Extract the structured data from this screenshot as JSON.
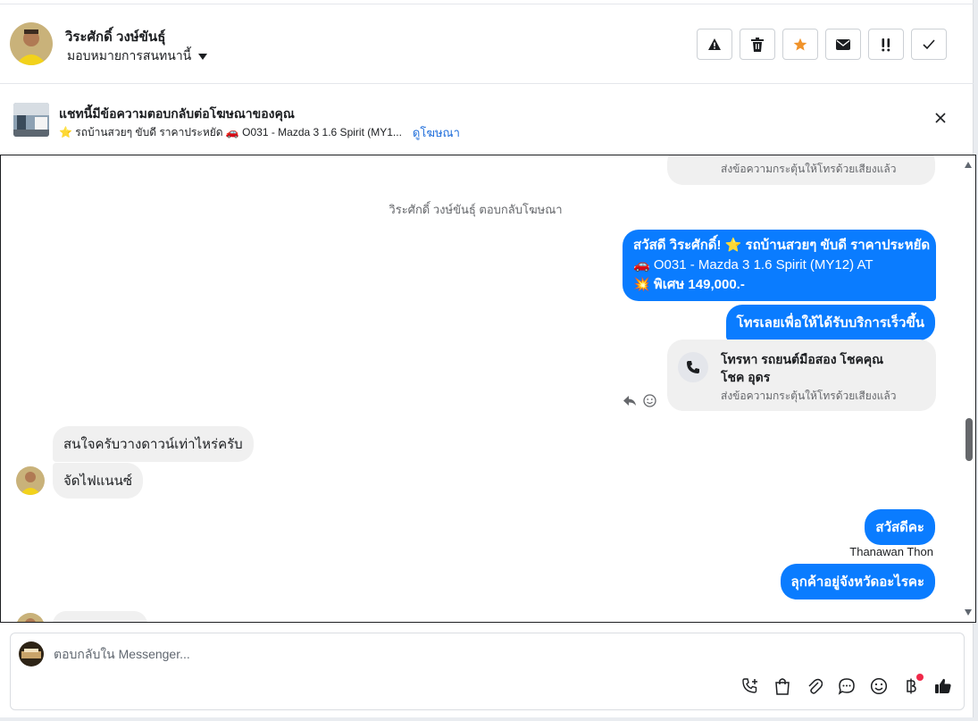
{
  "header": {
    "contact_name": "วิระศักดิ์ วงษ์ขันธุ์",
    "assign_label": "มอบหมายการสนทนานี้",
    "actions": [
      {
        "name": "report-spam-button",
        "icon": "warning-icon"
      },
      {
        "name": "delete-button",
        "icon": "trash-icon"
      },
      {
        "name": "star-button",
        "icon": "star-icon"
      },
      {
        "name": "mark-unread-button",
        "icon": "envelope-icon"
      },
      {
        "name": "follow-up-button",
        "icon": "exclamation-icon"
      },
      {
        "name": "mark-done-button",
        "icon": "check-icon"
      }
    ]
  },
  "ad_banner": {
    "title": "แชทนี้มีข้อความตอบกลับต่อโฆษณาของคุณ",
    "subtitle": "⭐ รถบ้านสวยๆ ขับดี ราคาประหยัด 🚗 O031 - Mazda 3 1.6 Spirit (MY1...",
    "link_label": "ดูโฆษณา"
  },
  "chat": {
    "top_card_sub": "ส่งข้อความกระตุ้นให้โทรด้วยเสียงแล้ว",
    "system_note": "วิระศักดิ์ วงษ์ขันธุ์ ตอบกลับโฆษณา",
    "msg1_line1": "สวัสดี วิระศักดิ์! ⭐ รถบ้านสวยๆ ขับดี ราคาประหยัด",
    "msg1_line2": "🚗 O031 - Mazda 3 1.6 Spirit (MY12) AT",
    "msg1_line3": "💥 พิเศษ 149,000.-",
    "msg2": "โทรเลยเพื่อให้ได้รับบริการเร็วขึ้น",
    "call_card_title_1": "โทรหา รถยนต์มือสอง โชคคุณ",
    "call_card_title_2": "โชค อุดร",
    "call_card_sub": "ส่งข้อความกระตุ้นให้โทรด้วยเสียงแล้ว",
    "incoming1": "สนใจครับวางดาวน์เท่าไหร่ครับ",
    "incoming2": "จัดไฟแนนซ์",
    "msg3": "สวัสดีคะ",
    "sender_name": "Thanawan Thon",
    "msg4": "ลุกค้าอยู่จังหวัดอะไรคะ"
  },
  "composer": {
    "placeholder": "ตอบกลับใน Messenger...",
    "tools": [
      "add-call-icon",
      "bag-icon",
      "paperclip-icon",
      "chat-bubble-icon",
      "smiley-icon",
      "baht-icon",
      "thumbs-up-icon"
    ]
  },
  "colors": {
    "accent": "#0a7cff",
    "star": "#f0932b",
    "notification_dot": "#f02849"
  }
}
